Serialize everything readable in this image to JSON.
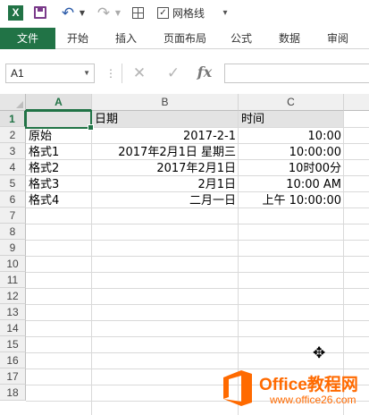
{
  "qat": {
    "app_icon": "X",
    "gridlines_checked": "✓",
    "gridlines_label": "网格线",
    "icons": [
      "excel-logo-icon",
      "save-icon",
      "undo-icon",
      "redo-icon",
      "borders-icon",
      "checkbox-icon",
      "customize-qat-icon"
    ]
  },
  "ribbon": {
    "tabs": [
      "文件",
      "开始",
      "插入",
      "页面布局",
      "公式",
      "数据",
      "审阅"
    ],
    "accent": "#217346"
  },
  "formula_bar": {
    "name_box": "A1",
    "cancel": "✕",
    "enter": "✓",
    "fx": "fx",
    "value": ""
  },
  "sheet": {
    "columns": [
      "A",
      "B",
      "C"
    ],
    "rows": [
      "1",
      "2",
      "3",
      "4",
      "5",
      "6",
      "7",
      "8",
      "9",
      "10",
      "11",
      "12",
      "13",
      "14",
      "15",
      "16",
      "17",
      "18"
    ],
    "selected_cell": "A1",
    "header_row": {
      "A": "",
      "B": "日期",
      "C": "时间"
    },
    "data": [
      {
        "A": "原始",
        "B": "2017-2-1",
        "C": "10:00"
      },
      {
        "A": "格式1",
        "B": "2017年2月1日 星期三",
        "C": "10:00:00"
      },
      {
        "A": "格式2",
        "B": "2017年2月1日",
        "C": "10时00分"
      },
      {
        "A": "格式3",
        "B": "2月1日",
        "C": "10:00 AM"
      },
      {
        "A": "格式4",
        "B": "二月一日",
        "C": "上午 10:00:00"
      }
    ]
  },
  "watermark": {
    "brand": "Office教程网",
    "url": "www.office26.com"
  }
}
